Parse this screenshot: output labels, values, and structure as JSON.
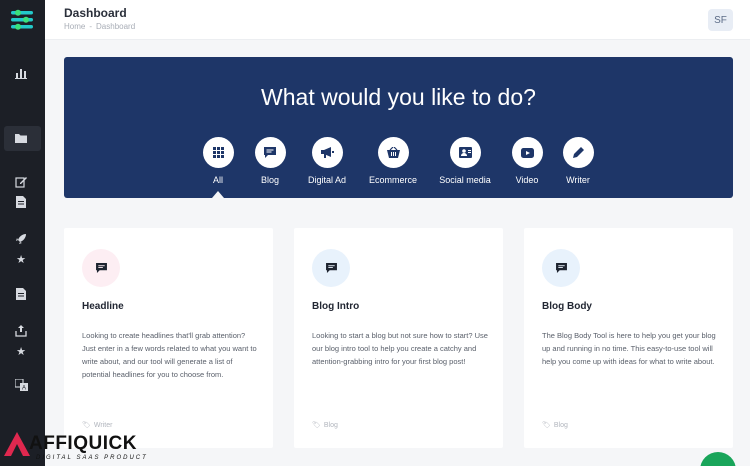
{
  "sidebar": {
    "items": [
      {
        "icon": "bar-chart-icon"
      },
      {
        "icon": "folder-icon",
        "active": true
      },
      {
        "icon": "edit-icon"
      },
      {
        "icon": "document-icon"
      },
      {
        "icon": "rocket-icon"
      },
      {
        "icon": "star-icon"
      },
      {
        "icon": "document-icon"
      },
      {
        "icon": "upload-icon"
      },
      {
        "icon": "star-icon"
      },
      {
        "icon": "translate-icon"
      }
    ]
  },
  "header": {
    "title": "Dashboard",
    "breadcrumb": [
      "Home",
      "Dashboard"
    ],
    "avatar": "SF"
  },
  "hero": {
    "title": "What would you like to do?",
    "categories": [
      {
        "label": "All",
        "icon": "grid-icon",
        "selected": true
      },
      {
        "label": "Blog",
        "icon": "chat-icon"
      },
      {
        "label": "Digital Ad",
        "icon": "megaphone-icon"
      },
      {
        "label": "Ecommerce",
        "icon": "basket-icon"
      },
      {
        "label": "Social media",
        "icon": "user-group-icon"
      },
      {
        "label": "Video",
        "icon": "video-icon"
      },
      {
        "label": "Writer",
        "icon": "pen-icon"
      }
    ]
  },
  "cards": [
    {
      "title": "Headline",
      "description": "Looking to create headlines that'll grab attention? Just enter in a few words related to what you want to write about, and our tool will generate a list of potential headlines for you to choose from.",
      "tag": "Writer",
      "icon": "chat-icon",
      "icon_bg": "#fdeef3"
    },
    {
      "title": "Blog Intro",
      "description": "Looking to start a blog but not sure how to start? Use our blog intro tool to help you create a catchy and attention-grabbing intro for your first blog post!",
      "tag": "Blog",
      "icon": "chat-icon",
      "icon_bg": "#e8f2fc"
    },
    {
      "title": "Blog Body",
      "description": "The Blog Body Tool is here to help you get your blog up and running in no time. This easy-to-use tool will help you come up with ideas for what to write about.",
      "tag": "Blog",
      "icon": "chat-icon",
      "icon_bg": "#e8f2fc"
    }
  ],
  "watermark": {
    "name": "AFFIQUICK",
    "tagline": "DIGITAL SAAS PRODUCT"
  },
  "colors": {
    "hero_bg": "#1e3668",
    "sidebar_bg": "#1c1f26",
    "accent_green": "#19a55a"
  }
}
